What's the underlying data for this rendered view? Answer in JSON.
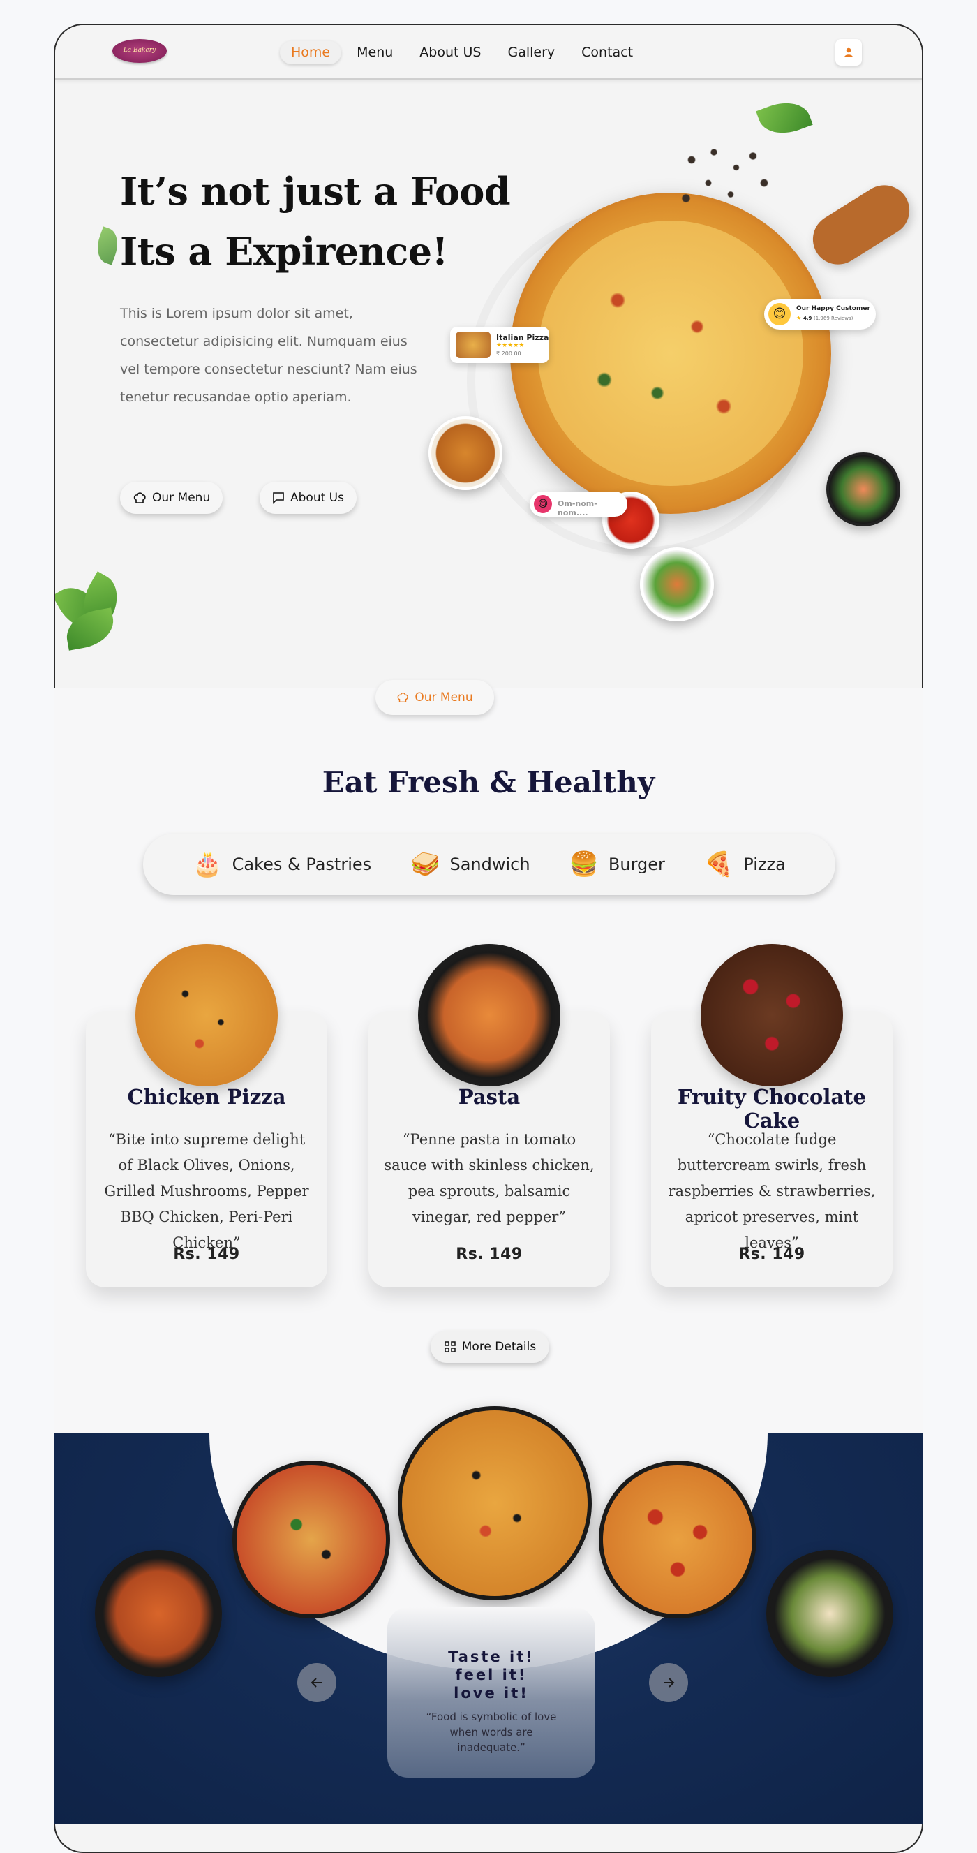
{
  "brand": {
    "logo_text": "La Bakery"
  },
  "nav": {
    "items": [
      {
        "label": "Home",
        "active": true
      },
      {
        "label": "Menu",
        "active": false
      },
      {
        "label": "About US",
        "active": false
      },
      {
        "label": "Gallery",
        "active": false
      },
      {
        "label": "Contact",
        "active": false
      }
    ],
    "accent_color": "#e97a20"
  },
  "hero": {
    "title_line1": "It’s not just a Food",
    "title_line2": "Its a Expirence!",
    "description": "This is Lorem ipsum dolor sit amet, consectetur adipisicing elit. Numquam eius vel tempore consectetur nesciunt? Nam eius tenetur recusandae optio aperiam.",
    "buttons": {
      "menu": "Our Menu",
      "about": "About Us"
    },
    "chips": {
      "pizza_name": "Italian Pizza",
      "pizza_price": "₹ 200.00",
      "customer_title": "Our Happy Customer",
      "customer_rating": "4.9",
      "customer_reviews": "(1.969 Reviews)",
      "comment": "Om-nom-nom...."
    }
  },
  "menu_section": {
    "pill_label": "Our Menu",
    "title": "Eat Fresh & Healthy",
    "categories": [
      {
        "label": "Cakes & Pastries",
        "icon": "🎂"
      },
      {
        "label": "Sandwich",
        "icon": "🥪"
      },
      {
        "label": "Burger",
        "icon": "🍔"
      },
      {
        "label": "Pizza",
        "icon": "🍕"
      }
    ],
    "cards": [
      {
        "title": "Chicken Pizza",
        "description": "“Bite into supreme delight of Black Olives, Onions, Grilled Mushrooms, Pepper BBQ Chicken, Peri-Peri Chicken”",
        "price": "Rs. 149"
      },
      {
        "title": "Pasta",
        "description": "“Penne pasta in tomato sauce with skinless chicken, pea sprouts, balsamic vinegar, red pepper”",
        "price": "Rs. 149"
      },
      {
        "title": "Fruity Chocolate Cake",
        "description": "“Chocolate fudge buttercream swirls, fresh raspberries & strawberries, apricot preserves, mint leaves”",
        "price": "Rs. 149"
      }
    ],
    "more_label": "More Details"
  },
  "carousel": {
    "quote_title_1": "Taste it!",
    "quote_title_2": "feel it!",
    "quote_title_3": "love it!",
    "quote_text": "“Food is symbolic of love when words are inadequate.”"
  }
}
